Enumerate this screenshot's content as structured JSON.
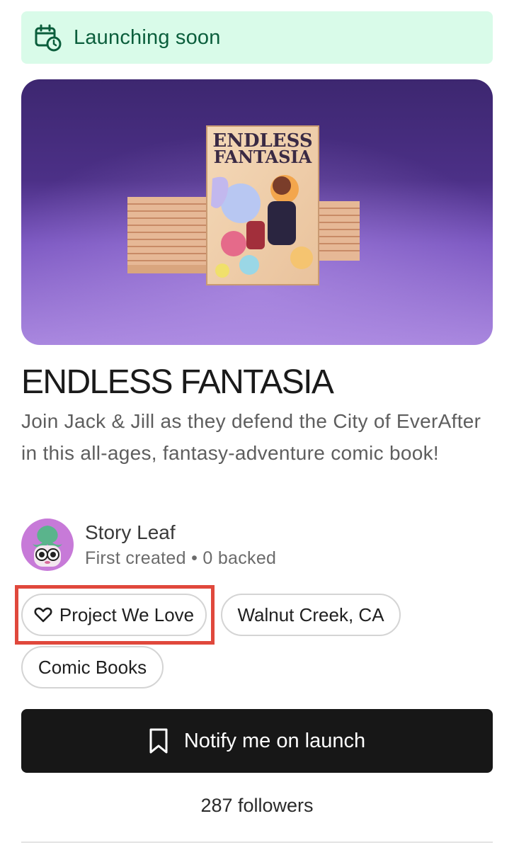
{
  "status_banner": {
    "label": "Launching soon",
    "icon": "calendar-clock-icon",
    "bg_color": "#d9fbe9",
    "text_color": "#0b5e3c"
  },
  "hero": {
    "book_title_line1": "ENDLESS",
    "book_title_line2": "FANTASIA"
  },
  "project": {
    "title": "ENDLESS FANTASIA",
    "description": "Join Jack & Jill as they defend the City of EverAfter in this all-ages, fantasy-adventure comic book!"
  },
  "creator": {
    "name": "Story Leaf",
    "meta": "First created • 0 backed"
  },
  "tags": {
    "project_we_love": "Project We Love",
    "location": "Walnut Creek, CA",
    "category": "Comic Books"
  },
  "cta": {
    "label": "Notify me on launch",
    "icon": "bookmark-icon"
  },
  "followers": "287 followers",
  "colors": {
    "highlight": "#e0483c",
    "button_bg": "#171717"
  }
}
